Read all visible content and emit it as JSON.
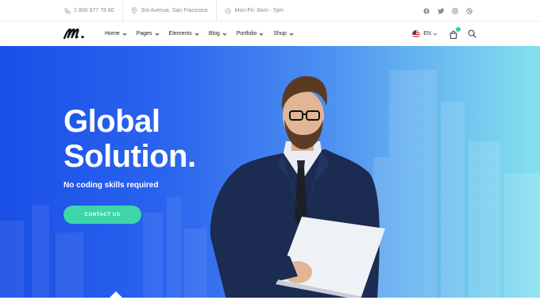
{
  "topbar": {
    "phone": "1 800 977 78 80",
    "address": "3rd Avenue, San Francisco",
    "hours": "Mon-Fri: 8am - 7pm",
    "social_icons": [
      "facebook-icon",
      "twitter-icon",
      "instagram-icon",
      "dribbble-icon"
    ]
  },
  "nav": {
    "logo_icon": "brand-logo-icon",
    "items": [
      {
        "label": "Home"
      },
      {
        "label": "Pages"
      },
      {
        "label": "Elements"
      },
      {
        "label": "Blog"
      },
      {
        "label": "Portfolio"
      },
      {
        "label": "Shop"
      }
    ],
    "language": "EN",
    "cart_icon": "cart-icon",
    "search_icon": "search-icon"
  },
  "hero": {
    "title_line1": "Global",
    "title_line2": "Solution.",
    "subtitle": "No coding skills required",
    "cta_label": "CONTACT US"
  },
  "colors": {
    "accent": "#3ed5a9",
    "hero_start": "#1a4fe6",
    "hero_end": "#84e0ee"
  }
}
